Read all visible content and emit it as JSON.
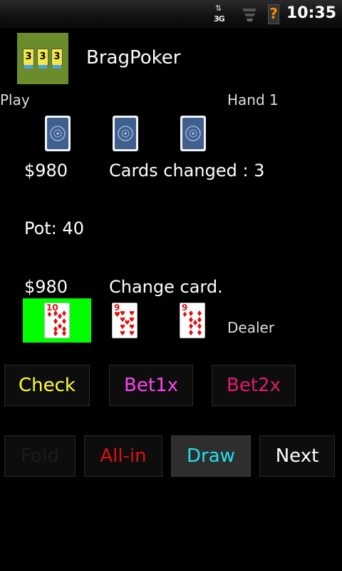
{
  "status_bar": {
    "network_label": "3G",
    "time": "10:35",
    "icons": [
      "network-3g-icon",
      "signal-icon",
      "battery-unknown-icon"
    ]
  },
  "app": {
    "title": "BragPoker",
    "icon_cards": [
      "3",
      "3",
      "3"
    ],
    "icon_color": "#6a8c2a"
  },
  "game": {
    "mode_label": "Play",
    "hand_label": "Hand 1",
    "opponent": {
      "money": "$980",
      "status": "Cards changed : 3",
      "cards": [
        "card-back",
        "card-back",
        "card-back"
      ]
    },
    "pot": "Pot: 40",
    "player": {
      "money": "$980",
      "status": "Change card.",
      "dealer_label": "Dealer",
      "cards": [
        {
          "rank": "10",
          "suit": "diamonds",
          "selected": true
        },
        {
          "rank": "9",
          "suit": "hearts",
          "selected": false
        },
        {
          "rank": "9",
          "suit": "diamonds",
          "selected": false
        }
      ]
    }
  },
  "actions": {
    "check": "Check",
    "bet1x": "Bet1x",
    "bet2x": "Bet2x",
    "fold": "Fold",
    "allin": "All-in",
    "draw": "Draw",
    "next": "Next"
  },
  "colors": {
    "highlight": "#00ff00",
    "check": "#ffff33",
    "bet1x": "#ff44ee",
    "bet2x": "#e01a6e",
    "allin": "#dd1111",
    "draw": "#22e0ee"
  }
}
